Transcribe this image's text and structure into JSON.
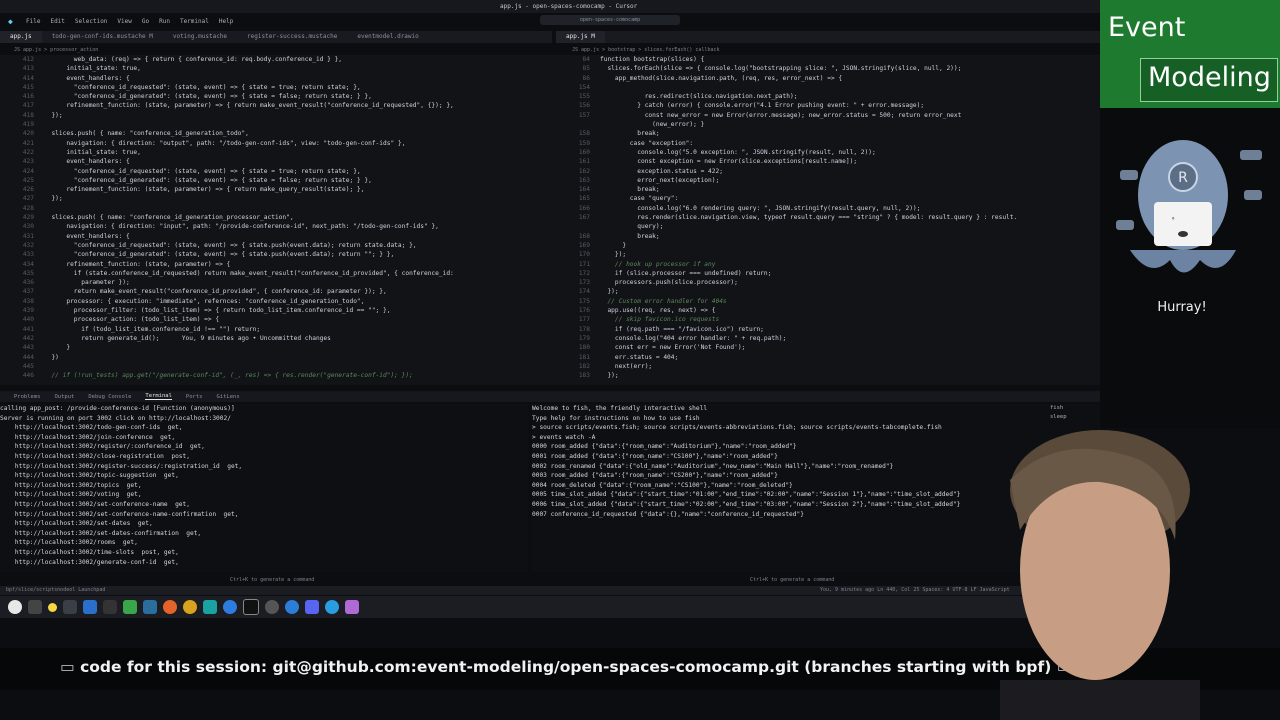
{
  "window": {
    "title": "app.js - open-spaces-comocamp - Cursor",
    "search_text": "open-spaces-comocamp",
    "menu": [
      "File",
      "Edit",
      "Selection",
      "View",
      "Go",
      "Run",
      "Terminal",
      "Help"
    ]
  },
  "left_editor": {
    "tabs": [
      {
        "label": "app.js",
        "active": true
      },
      {
        "label": "todo-gen-conf-ids.mustache M",
        "active": false
      },
      {
        "label": "voting.mustache",
        "active": false
      },
      {
        "label": "register-success.mustache",
        "active": false
      },
      {
        "label": "eventmodel.drawio",
        "active": false
      }
    ],
    "breadcrumb": "JS app.js > processor_action",
    "lines": [
      {
        "n": "412",
        "t": "        web_data: (req) => { return { conference_id: req.body.conference_id } },"
      },
      {
        "n": "413",
        "t": "      initial_state: true,"
      },
      {
        "n": "414",
        "t": "      event_handlers: {"
      },
      {
        "n": "415",
        "t": "        \"conference_id_requested\": (state, event) => { state = true; return state; },"
      },
      {
        "n": "416",
        "t": "        \"conference_id_generated\": (state, event) => { state = false; return state; } },"
      },
      {
        "n": "417",
        "t": "      refinement_function: (state, parameter) => { return make_event_result(\"conference_id_requested\", {}); },"
      },
      {
        "n": "418",
        "t": "  });"
      },
      {
        "n": "419",
        "t": ""
      },
      {
        "n": "420",
        "t": "  slices.push( { name: \"conference_id_generation_todo\","
      },
      {
        "n": "421",
        "t": "      navigation: { direction: \"output\", path: \"/todo-gen-conf-ids\", view: \"todo-gen-conf-ids\" },"
      },
      {
        "n": "422",
        "t": "      initial_state: true,"
      },
      {
        "n": "423",
        "t": "      event_handlers: {"
      },
      {
        "n": "424",
        "t": "        \"conference_id_requested\": (state, event) => { state = true; return state; },"
      },
      {
        "n": "425",
        "t": "        \"conference_id_generated\": (state, event) => { state = false; return state; } },"
      },
      {
        "n": "426",
        "t": "      refinement_function: (state, parameter) => { return make_query_result(state); },"
      },
      {
        "n": "427",
        "t": "  });"
      },
      {
        "n": "428",
        "t": ""
      },
      {
        "n": "429",
        "t": "  slices.push( { name: \"conference_id_generation_processor_action\","
      },
      {
        "n": "430",
        "t": "      navigation: { direction: \"input\", path: \"/provide-conference-id\", next_path: \"/todo-gen-conf-ids\" },"
      },
      {
        "n": "431",
        "t": "      event_handlers: {"
      },
      {
        "n": "432",
        "t": "        \"conference_id_requested\": (state, event) => { state.push(event.data); return state.data; },"
      },
      {
        "n": "433",
        "t": "        \"conference_id_generated\": (state, event) => { state.push(event.data); return \"\"; } },"
      },
      {
        "n": "434",
        "t": "      refinement_function: (state, parameter) => {"
      },
      {
        "n": "435",
        "t": "        if (state.conference_id_requested) return make_event_result(\"conference_id_provided\", { conference_id:"
      },
      {
        "n": "436",
        "t": "          parameter });"
      },
      {
        "n": "437",
        "t": "        return make_event_result(\"conference_id_provided\", { conference_id: parameter }); },"
      },
      {
        "n": "438",
        "t": "      processor: { execution: \"immediate\", refernces: \"conference_id_generation_todo\","
      },
      {
        "n": "439",
        "t": "        processor_filter: (todo_list_item) => { return todo_list_item.conference_id == \"\"; },"
      },
      {
        "n": "440",
        "t": "        processor_action: (todo_list_item) => {"
      },
      {
        "n": "441",
        "t": "          if (todo_list_item.conference_id !== \"\") return;"
      },
      {
        "n": "442",
        "t": "          return generate_id();      You, 9 minutes ago • Uncommitted changes"
      },
      {
        "n": "443",
        "t": "      }"
      },
      {
        "n": "444",
        "t": "  })"
      },
      {
        "n": "445",
        "t": ""
      },
      {
        "n": "446",
        "t": "  // if (!run_tests) app.get(\"/generate-conf-id\", (_, res) => { res.render(\"generate-conf-id\"); });"
      }
    ]
  },
  "right_editor": {
    "tabs": [
      {
        "label": "app.js M",
        "active": true
      }
    ],
    "breadcrumb": "JS app.js > bootstrap > slices.forEach() callback",
    "lines": [
      {
        "n": "84",
        "t": "function bootstrap(slices) {"
      },
      {
        "n": "85",
        "t": "  slices.forEach(slice => { console.log(\"bootstrapping slice: \", JSON.stringify(slice, null, 2));"
      },
      {
        "n": "86",
        "t": "    app_method(slice.navigation.path, (req, res, error_next) => {"
      },
      {
        "n": "154",
        "t": ""
      },
      {
        "n": "155",
        "t": "            res.redirect(slice.navigation.next_path);"
      },
      {
        "n": "156",
        "t": "          } catch (error) { console.error(\"4.1 Error pushing event: \" + error.message);"
      },
      {
        "n": "157",
        "t": "            const new_error = new Error(error.message); new_error.status = 500; return error_next"
      },
      {
        "n": "",
        "t": "              (new_error); }"
      },
      {
        "n": "158",
        "t": "          break;"
      },
      {
        "n": "159",
        "t": "        case \"exception\":"
      },
      {
        "n": "160",
        "t": "          console.log(\"5.0 exception: \", JSON.stringify(result, null, 2));"
      },
      {
        "n": "161",
        "t": "          const exception = new Error(slice.exceptions[result.name]);"
      },
      {
        "n": "162",
        "t": "          exception.status = 422;"
      },
      {
        "n": "163",
        "t": "          error_next(exception);"
      },
      {
        "n": "164",
        "t": "          break;"
      },
      {
        "n": "165",
        "t": "        case \"query\":"
      },
      {
        "n": "166",
        "t": "          console.log(\"6.0 rendering query: \", JSON.stringify(result.query, null, 2));"
      },
      {
        "n": "167",
        "t": "          res.render(slice.navigation.view, typeof result.query === \"string\" ? { model: result.query } : result."
      },
      {
        "n": "",
        "t": "          query);"
      },
      {
        "n": "168",
        "t": "          break;"
      },
      {
        "n": "169",
        "t": "      }"
      },
      {
        "n": "170",
        "t": "    });"
      },
      {
        "n": "171",
        "t": "    // hook up processor if any"
      },
      {
        "n": "172",
        "t": "    if (slice.processor === undefined) return;"
      },
      {
        "n": "173",
        "t": "    processors.push(slice.processor);"
      },
      {
        "n": "174",
        "t": "  });"
      },
      {
        "n": "175",
        "t": "  // Custom error handler for 404s"
      },
      {
        "n": "176",
        "t": "  app.use((req, res, next) => {"
      },
      {
        "n": "177",
        "t": "    // skip favicon.ico requests"
      },
      {
        "n": "178",
        "t": "    if (req.path === \"/favicon.ico\") return;"
      },
      {
        "n": "179",
        "t": "    console.log(\"404 error handler: \" + req.path);"
      },
      {
        "n": "180",
        "t": "    const err = new Error('Not Found');"
      },
      {
        "n": "181",
        "t": "    err.status = 404;"
      },
      {
        "n": "182",
        "t": "    next(err);"
      },
      {
        "n": "183",
        "t": "  });"
      }
    ]
  },
  "panel": {
    "tabs": [
      "Problems",
      "Output",
      "Debug Console",
      "Terminal",
      "Ports",
      "GitLens"
    ],
    "active_tab": "Terminal",
    "terminal_list": [
      "fish",
      "sleep"
    ]
  },
  "terminal_left": [
    "calling app_post: /provide-conference-id [Function (anonymous)]",
    "Server is running on port 3002 click on http://localhost:3002/",
    "    http://localhost:3002/todo-gen-conf-ids  get,",
    "    http://localhost:3002/join-conference  get,",
    "    http://localhost:3002/register/:conference_id  get,",
    "    http://localhost:3002/close-registration  post,",
    "    http://localhost:3002/register-success/:registration_id  get,",
    "    http://localhost:3002/topic-suggestion  get,",
    "    http://localhost:3002/topics  get,",
    "    http://localhost:3002/voting  get,",
    "    http://localhost:3002/set-conference-name  get,",
    "    http://localhost:3002/set-conference-name-confirmation  get,",
    "    http://localhost:3002/set-dates  get,",
    "    http://localhost:3002/set-dates-confirmation  get,",
    "    http://localhost:3002/rooms  get,",
    "    http://localhost:3002/time-slots  post, get,",
    "    http://localhost:3002/generate-conf-id  get,"
  ],
  "terminal_right": [
    "Welcome to fish, the friendly interactive shell",
    "Type help for instructions on how to use fish",
    "> source scripts/events.fish; source scripts/events-abbreviations.fish; source scripts/events-tabcomplete.fish",
    "> events watch -A",
    "0000 room_added {\"data\":{\"room_name\":\"Auditorium\"},\"name\":\"room_added\"}",
    "0001 room_added {\"data\":{\"room_name\":\"CS100\"},\"name\":\"room_added\"}",
    "0002 room_renamed {\"data\":{\"old_name\":\"Auditorium\",\"new_name\":\"Main Hall\"},\"name\":\"room_renamed\"}",
    "0003 room_added {\"data\":{\"room_name\":\"CS200\"},\"name\":\"room_added\"}",
    "0004 room_deleted {\"data\":{\"room_name\":\"CS100\"},\"name\":\"room_deleted\"}",
    "0005 time_slot_added {\"data\":{\"start_time\":\"01:00\",\"end_time\":\"02:00\",\"name\":\"Session 1\"},\"name\":\"time_slot_added\"}",
    "0006 time_slot_added {\"data\":{\"start_time\":\"02:00\",\"end_time\":\"03:00\",\"name\":\"Session 2\"},\"name\":\"time_slot_added\"}",
    "0007 conference_id_requested {\"data\":{},\"name\":\"conference_id_requested\"}"
  ],
  "terminal_hints": {
    "left": "Ctrl+K to generate a command",
    "right": "Ctrl+K to generate a command"
  },
  "statusbar": {
    "left": "bpf/slice/scriptsnodeol    Launchpad",
    "right": "You, 9 minutes ago    Ln 440, Col 25   Spaces: 4   UTF-8   LF   JavaScript"
  },
  "logo": {
    "word1": "Ev",
    "word1b": "ent",
    "word2": "Mo",
    "word2b": "deling"
  },
  "overlay": {
    "hurray": "Hurray!"
  },
  "banner": {
    "text": "code for this session: git@github.com:event-modeling/open-spaces-comocamp.git (branches starting with bpf)"
  },
  "colors": {
    "logo_green": "#1e7a2e",
    "editor_bg": "#111317",
    "terminal_bg": "#0e0f12"
  }
}
